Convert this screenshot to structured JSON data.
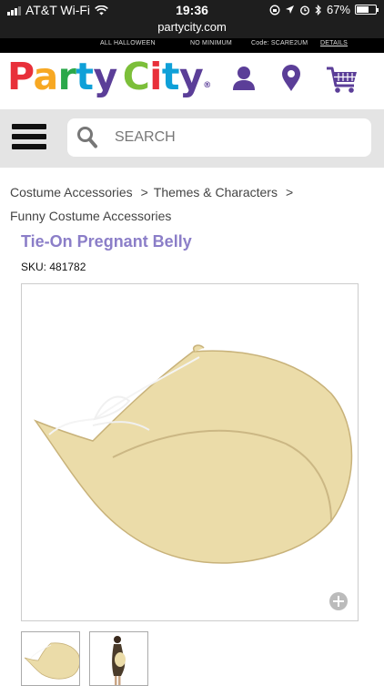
{
  "status_bar": {
    "carrier": "AT&T Wi-Fi",
    "time": "19:36",
    "battery_text": "67%",
    "battery_level": 0.67
  },
  "browser": {
    "url": "partycity.com"
  },
  "promo_bar": {
    "left": "ALL HALLOWEEN",
    "middle": "NO MINIMUM",
    "code": "Code: SCARE2UM",
    "details": "DETAILS"
  },
  "header": {
    "logo_word1": [
      "P",
      "a",
      "r",
      "t",
      "y"
    ],
    "logo_word2": [
      "C",
      "i",
      "t",
      "y"
    ],
    "logo_colors": [
      "#e8303a",
      "#f7a823",
      "#2aa84a",
      "#0fa0d8",
      "#5b3e98",
      "#7cbf3a",
      "#e8303a",
      "#0fa0d8",
      "#5b3e98"
    ],
    "logo_reg": "®",
    "icons": [
      "account-icon",
      "store-locator-icon",
      "cart-icon"
    ],
    "brand_color": "#5b3e98"
  },
  "search": {
    "placeholder": "SEARCH"
  },
  "breadcrumb": {
    "items": [
      "Costume Accessories",
      "Themes & Characters",
      "Funny Costume Accessories"
    ],
    "separator": ">"
  },
  "product": {
    "title": "Tie-On Pregnant Belly",
    "sku": "SKU: 481782"
  }
}
